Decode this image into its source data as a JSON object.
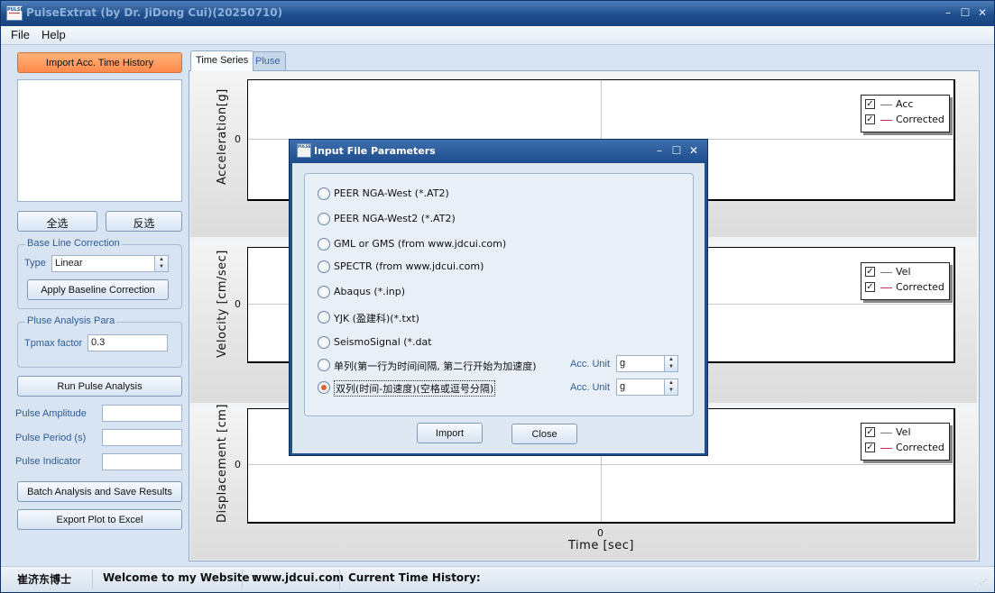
{
  "window": {
    "title": "PulseExtrat (by Dr. JiDong Cui)(20250710)",
    "app_icon_text": "PULSE",
    "controls": {
      "minimize": "–",
      "maximize": "☐",
      "close": "✕"
    }
  },
  "menu": {
    "file": "File",
    "help": "Help"
  },
  "left_panel": {
    "import_button": "Import Acc. Time History",
    "select_all": "全选",
    "invert_select": "反选",
    "baseline": {
      "group_title": "Base Line Correction",
      "type_label": "Type",
      "type_value": "Linear",
      "apply_button": "Apply Baseline Correction"
    },
    "pulse_para": {
      "group_title": "Pluse Analysis Para",
      "tpmax_label": "Tpmax factor",
      "tpmax_value": "0.3"
    },
    "run_button": "Run Pulse Analysis",
    "amplitude_label": "Pulse Amplitude",
    "amplitude_value": "",
    "period_label": "Pulse Period (s)",
    "period_value": "",
    "indicator_label": "Pulse Indicator",
    "indicator_value": "",
    "batch_button": "Batch Analysis and Save Results",
    "export_button": "Export Plot to Excel"
  },
  "tabs": [
    {
      "label": "Time Series",
      "active": true
    },
    {
      "label": "Pluse",
      "active": false
    }
  ],
  "plots": [
    {
      "ylabel": "Acceleration[g]",
      "ytick": "0",
      "legend": [
        {
          "label": "Acc",
          "color": "#7a7a7a",
          "checked": true
        },
        {
          "label": "Corrected",
          "color": "#c0306a",
          "checked": true
        }
      ]
    },
    {
      "ylabel": "Velocity [cm/sec]",
      "ytick": "0",
      "legend": [
        {
          "label": "Vel",
          "color": "#7a7a7a",
          "checked": true
        },
        {
          "label": "Corrected",
          "color": "#c0306a",
          "checked": true
        }
      ]
    },
    {
      "ylabel": "Displacement [cm]",
      "ytick": "0",
      "legend": [
        {
          "label": "Vel",
          "color": "#7a7a7a",
          "checked": true
        },
        {
          "label": "Corrected",
          "color": "#c0306a",
          "checked": true
        }
      ]
    }
  ],
  "xaxis": {
    "label": "Time [sec]",
    "tick": "0"
  },
  "status": {
    "author": "崔济东博士",
    "welcome": "Welcome to my Website :",
    "site": "www.jdcui.com",
    "current": "Current Time History:"
  },
  "dialog": {
    "title": "Input File Parameters",
    "options": [
      {
        "label": "PEER NGA-West (*.AT2)",
        "checked": false
      },
      {
        "label": "PEER NGA-West2 (*.AT2)",
        "checked": false
      },
      {
        "label": "GML or GMS (from www.jdcui.com)",
        "checked": false
      },
      {
        "label": "SPECTR (from www.jdcui.com)",
        "checked": false
      },
      {
        "label": "Abaqus (*.inp)",
        "checked": false
      },
      {
        "label": "YJK (盈建科)(*.txt)",
        "checked": false
      },
      {
        "label": "SeismoSignal (*.dat",
        "checked": false
      },
      {
        "label": "单列(第一行为时间间隔, 第二行开始为加速度)",
        "checked": false
      },
      {
        "label": "双列(时间-加速度)(空格或逗号分隔)",
        "checked": true
      }
    ],
    "acc_unit_label": "Acc. Unit",
    "acc_unit_single": "g",
    "acc_unit_double": "g",
    "import_button": "Import",
    "close_button": "Close",
    "colors": {
      "selected_radio": "#e0602c"
    }
  }
}
